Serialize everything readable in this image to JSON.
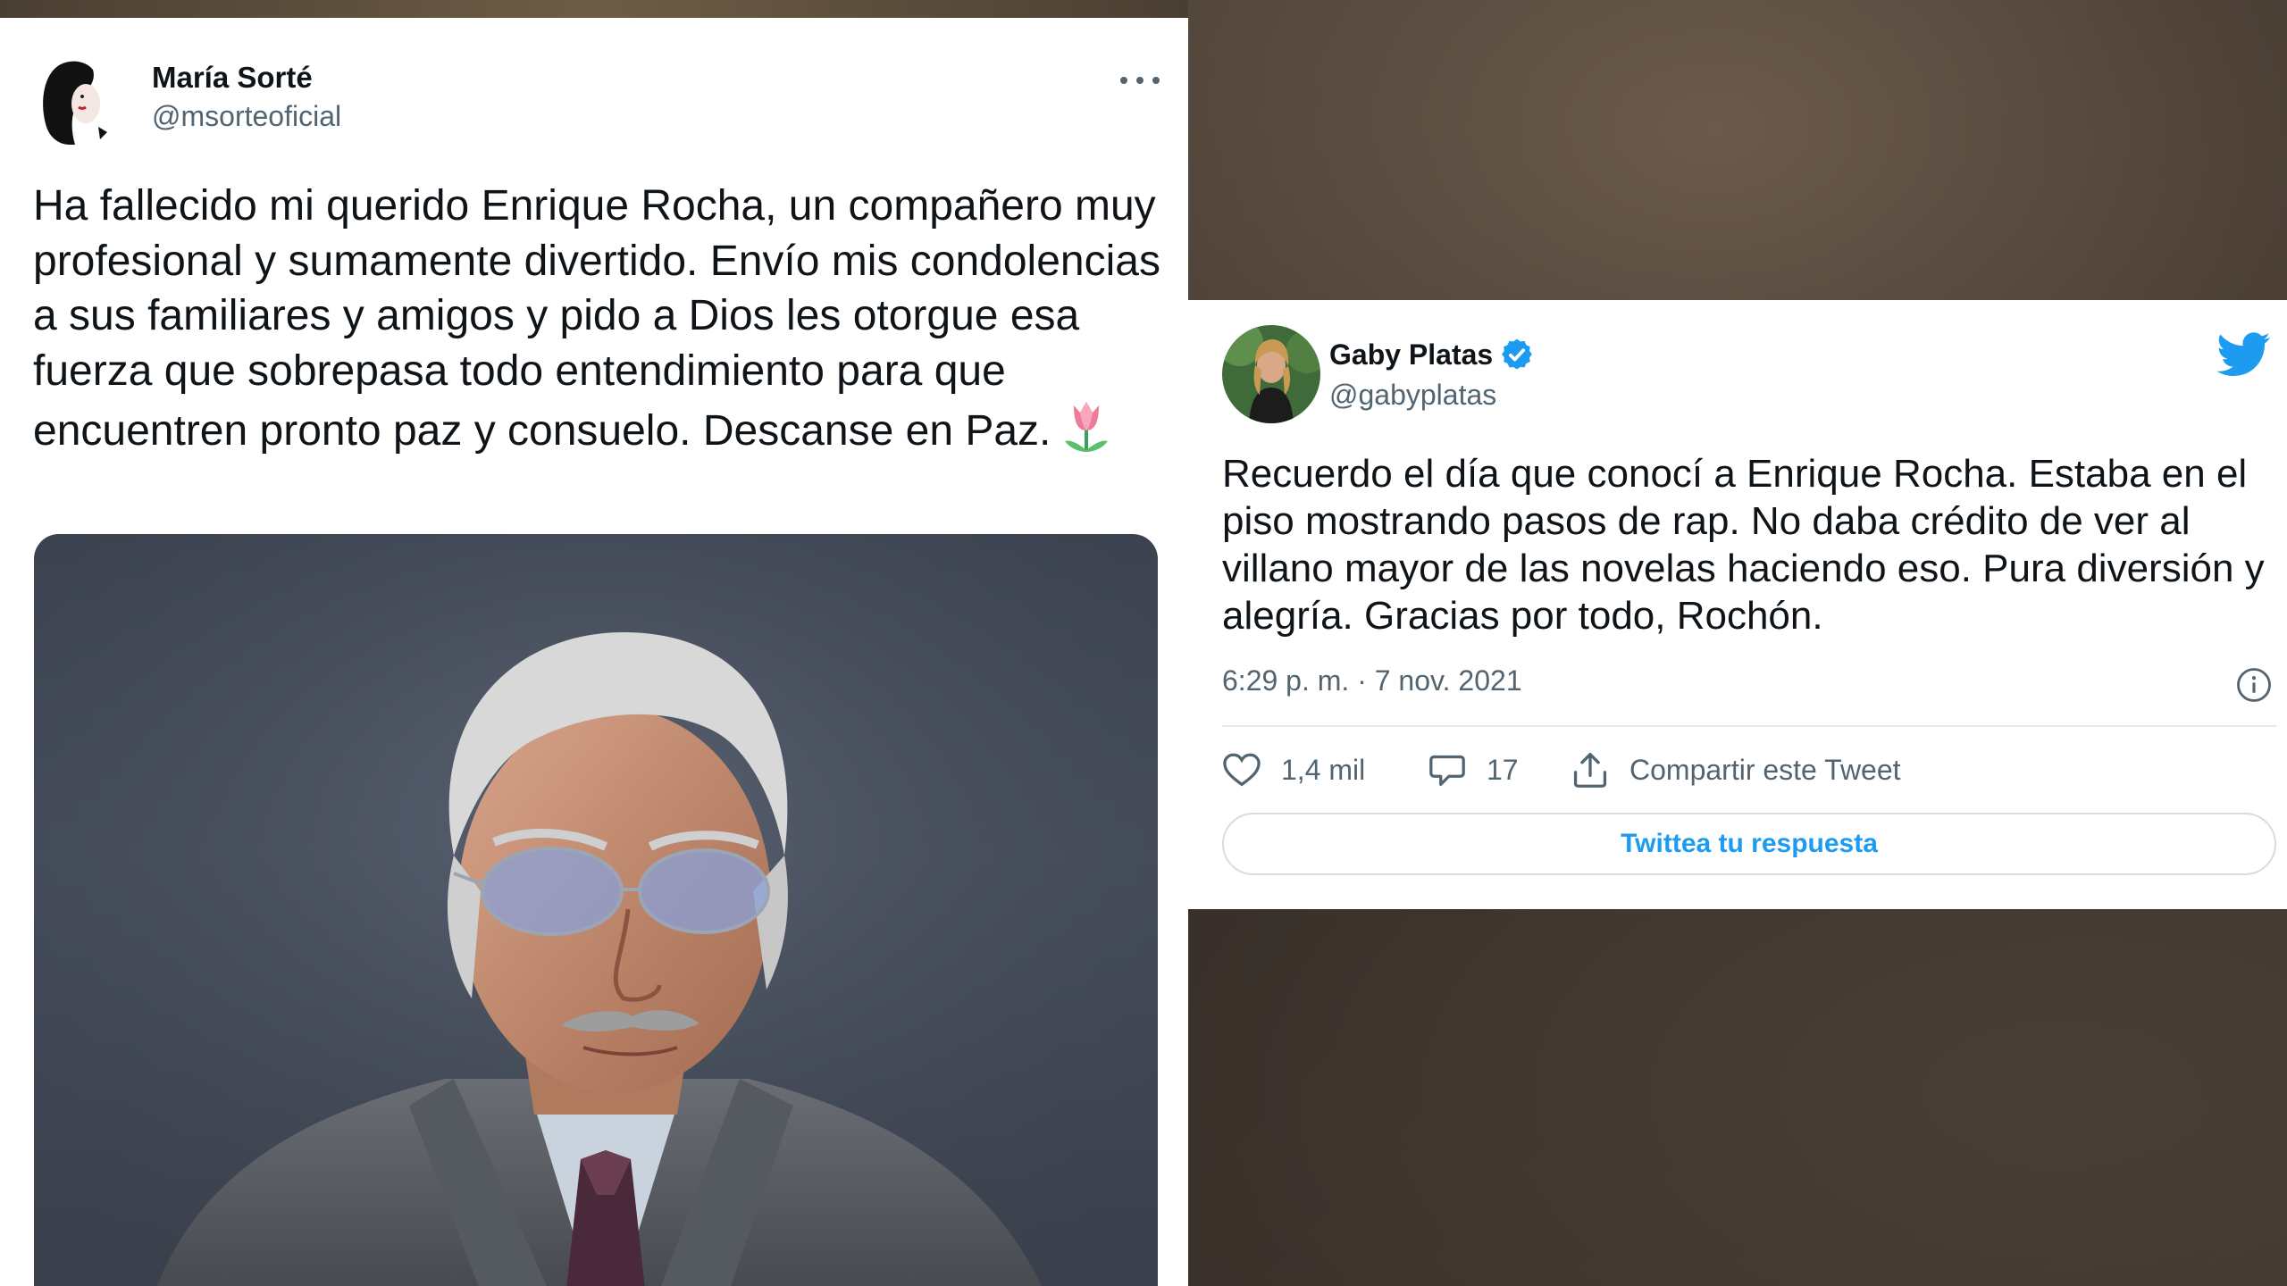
{
  "left_tweet": {
    "author_name": "María Sorté",
    "author_handle": "@msorteoficial",
    "more_label": "More options",
    "text": "Ha fallecido mi querido Enrique Rocha, un compañero muy profesional y sumamente divertido. Envío mis condolencias a sus familiares y amigos y pido a Dios les otorgue esa fuerza que sobrepasa todo entendimiento para que encuentren pronto paz y consuelo. Descanse en Paz."
  },
  "right_tweet": {
    "author_name": "Gaby Platas",
    "author_handle": "@gabyplatas",
    "text": "Recuerdo el día que conocí a Enrique Rocha. Estaba en el piso mostrando pasos de rap. No daba crédito de ver al villano mayor de las novelas haciendo eso. Pura diversión y alegría. Gracias por todo, Rochón.",
    "timestamp": "6:29 p. m. · 7 nov. 2021",
    "likes": "1,4 mil",
    "replies": "17",
    "share_label": "Compartir este Tweet",
    "reply_button": "Twittea tu respuesta"
  },
  "colors": {
    "twitter_blue": "#1d9bf0",
    "text_primary": "#0f1419",
    "text_secondary": "#536471"
  }
}
